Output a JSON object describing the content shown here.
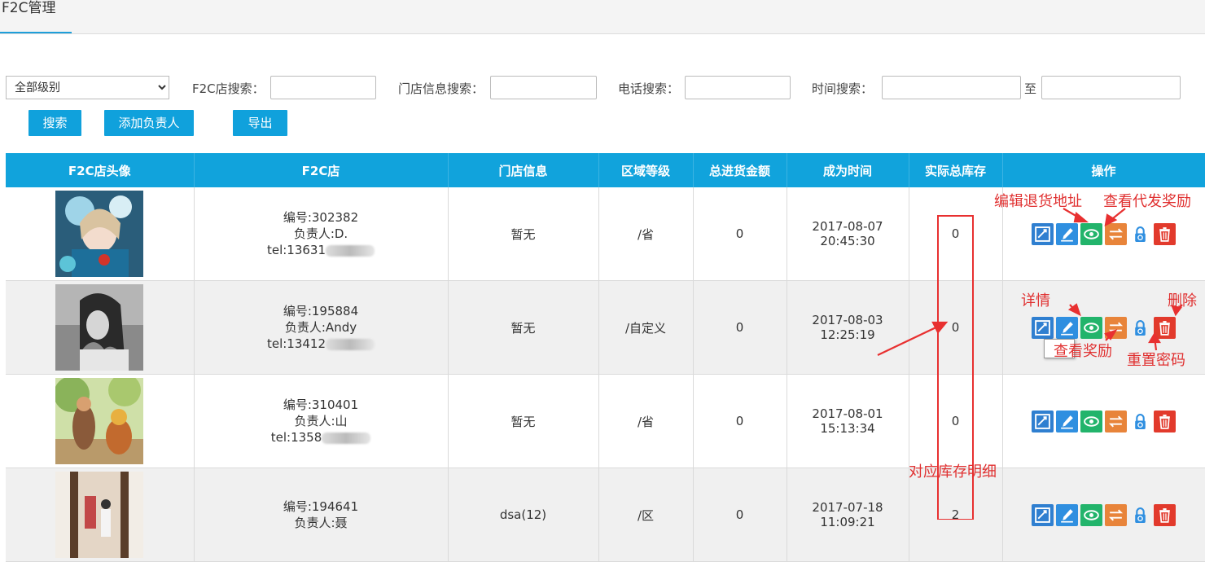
{
  "header": {
    "tab": "F2C管理"
  },
  "filters": {
    "level_select": "全部级别",
    "f2c_search_label": "F2C店搜索：",
    "store_info_search_label": "门店信息搜索：",
    "phone_search_label": "电话搜索：",
    "time_search_label": "时间搜索：",
    "time_to_label": "至"
  },
  "buttons": {
    "search": "搜索",
    "add_person": "添加负责人",
    "export": "导出"
  },
  "table": {
    "columns": [
      "F2C店头像",
      "F2C店",
      "门店信息",
      "区域等级",
      "总进货金额",
      "成为时间",
      "实际总库存",
      "操作"
    ],
    "rows": [
      {
        "id_line": "编号:302382",
        "person_line": "负责人:D.",
        "tel_line": "tel:13631",
        "store_info": "暂无",
        "region": "/省",
        "total_purchase": "0",
        "date": "2017-08-07",
        "time": "20:45:30",
        "stock": "0"
      },
      {
        "id_line": "编号:195884",
        "person_line": "负责人:Andy",
        "tel_line": "tel:13412",
        "store_info": "暂无",
        "region": "/自定义",
        "total_purchase": "0",
        "date": "2017-08-03",
        "time": "12:25:19",
        "stock": "0"
      },
      {
        "id_line": "编号:310401",
        "person_line": "负责人:山",
        "tel_line": "tel:1358",
        "store_info": "暂无",
        "region": "/省",
        "total_purchase": "0",
        "date": "2017-08-01",
        "time": "15:13:34",
        "stock": "0"
      },
      {
        "id_line": "编号:194641",
        "person_line": "负责人:聂",
        "tel_line": "",
        "store_info": "dsa(12)",
        "region": "/区",
        "total_purchase": "0",
        "date": "2017-07-18",
        "time": "11:09:21",
        "stock": "2"
      }
    ]
  },
  "annotations": {
    "edit_return_address": "编辑退货地址",
    "view_proxy_reward": "查看代发奖励",
    "details": "详情",
    "delete": "删除",
    "view_reward": "查看奖励",
    "reset_password": "重置密码",
    "stock_detail": "对应库存明细"
  },
  "icons": [
    "detail-icon",
    "edit-address-icon",
    "view-reward-icon",
    "view-proxy-reward-icon",
    "reset-password-icon",
    "delete-icon"
  ],
  "colors": {
    "header_blue": "#11a3dc",
    "annotation_red": "#e03030",
    "op_blue": "#2f7fd0",
    "op_green": "#22b46b",
    "op_orange": "#e8843a",
    "op_red": "#e23a2c"
  }
}
